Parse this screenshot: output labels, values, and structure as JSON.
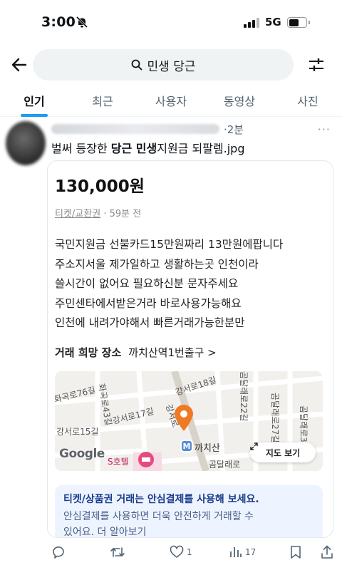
{
  "status": {
    "time": "3:00",
    "network": "5G"
  },
  "search": {
    "query": "민생 당근"
  },
  "tabs": [
    "인기",
    "최근",
    "사용자",
    "동영상",
    "사진"
  ],
  "tweet": {
    "time": "·2분",
    "text_pre": "벌써 등장한 ",
    "text_bold": "당근 민생",
    "text_post": "지원금 되팔렘.jpg",
    "more": "···"
  },
  "listing": {
    "price": "130,000원",
    "category": "티켓/교환권",
    "posted": " · 59분 전",
    "description": [
      "국민지원금 선불카드15만원짜리 13만원에팝니다",
      "주소지서울 제가일하고 생활하는곳 인천이라",
      "쓸시간이 없어요 필요하신분 문자주세요",
      "주민센타에서받은거라  바로사용가능해요",
      "인천에 내려가야해서 빠른거래가능한분만"
    ],
    "place_label": "거래 희망 장소",
    "place_value": "까치산역1번출구 >",
    "map": {
      "labels": [
        "화곡로43길",
        "강서로18길",
        "곰달래로22길",
        "곰달래로27길",
        "곰달래로31길",
        "화곡로76길",
        "강서로17길",
        "강서로15길",
        "강서로",
        "까치산",
        "곰달래로",
        "S호텔"
      ],
      "station_badge": "M",
      "attribution": "Google",
      "view_button": "지도 보기"
    },
    "notice_title": "티켓/상품권 거래는 안심결제를 사용해 보세요.",
    "notice_body_1": "안심결제를 사용하면 더욱 안전하게 거래할 수",
    "notice_body_2": "있어요. 더 알아보기"
  },
  "actions": {
    "likes": "1",
    "views": "17"
  },
  "colors": {
    "accent": "#1d9bf0",
    "pin": "#f07a24",
    "metro": "#5a8dd6"
  }
}
